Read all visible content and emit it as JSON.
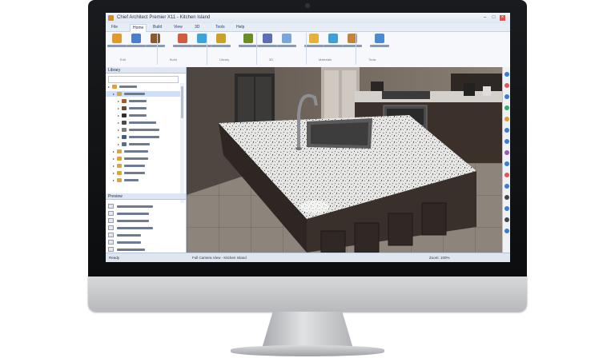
{
  "app": {
    "title": "Chief Architect Premier X11 - Kitchen Island",
    "tabs": [
      "File",
      "Home",
      "Build",
      "View",
      "3D",
      "Tools",
      "Help"
    ],
    "active_tab": "Home"
  },
  "ribbon": {
    "groups": [
      "Edit",
      "Build",
      "Library",
      "3D",
      "Materials",
      "Tools"
    ],
    "buttons": [
      {
        "icon": "select-icon",
        "color": "#e09b2d"
      },
      {
        "icon": "wall-icon",
        "color": "#4b7fc8"
      },
      {
        "icon": "cabinet-icon",
        "color": "#8c5a2b"
      },
      {
        "icon": "door-icon",
        "color": "#d15b3c"
      },
      {
        "icon": "window-icon",
        "color": "#3aa6d8"
      },
      {
        "icon": "room-icon",
        "color": "#c9a227"
      },
      {
        "icon": "roof-icon",
        "color": "#6b8e23"
      },
      {
        "icon": "camera-icon",
        "color": "#5a6fb8"
      },
      {
        "icon": "render-icon",
        "color": "#7aa7d8"
      },
      {
        "icon": "material-icon",
        "color": "#e3b23c"
      },
      {
        "icon": "paint-icon",
        "color": "#3fa0d6"
      },
      {
        "icon": "measure-icon",
        "color": "#c1843a"
      },
      {
        "icon": "layer-icon",
        "color": "#4a8bd0"
      }
    ]
  },
  "library": {
    "header": "Library",
    "search_placeholder": "Search Library",
    "tree": [
      {
        "label": "Architectural",
        "selected": false,
        "color": "#d9a441",
        "level": 0
      },
      {
        "label": "Cabinets",
        "selected": true,
        "color": "#d9a441",
        "level": 1
      },
      {
        "label": "Base Cabinets",
        "selected": false,
        "color": "#a35b2c",
        "level": 2
      },
      {
        "label": "Wall Cabinets",
        "selected": false,
        "color": "#6a4a2a",
        "level": 2
      },
      {
        "label": "Islands",
        "selected": false,
        "color": "#2f2f2f",
        "level": 2
      },
      {
        "label": "Appliances",
        "selected": false,
        "color": "#4a4a4a",
        "level": 2
      },
      {
        "label": "Countertops",
        "selected": false,
        "color": "#7a7a7a",
        "level": 2
      },
      {
        "label": "Sinks",
        "selected": false,
        "color": "#3b5b8a",
        "level": 2
      },
      {
        "label": "Fixtures",
        "selected": false,
        "color": "#5e6e7e",
        "level": 2
      },
      {
        "label": "Interiors",
        "selected": false,
        "color": "#d9a441",
        "level": 1
      },
      {
        "label": "Materials",
        "selected": false,
        "color": "#d9a441",
        "level": 1
      },
      {
        "label": "Exterior",
        "selected": false,
        "color": "#d9a441",
        "level": 1
      },
      {
        "label": "Lighting",
        "selected": false,
        "color": "#d9a441",
        "level": 1
      },
      {
        "label": "User Catalog",
        "selected": false,
        "color": "#d9a441",
        "level": 1
      }
    ],
    "preview_header": "Preview",
    "catalog_items": [
      "Granite Countertop",
      "Quartz Countertop",
      "Marble Countertop",
      "Butcher Block",
      "Stainless Steel Sink",
      "Undermount Sink",
      "Faucet"
    ]
  },
  "status": {
    "left": "Ready",
    "middle": "Full Camera View - Kitchen Island",
    "right": "Zoom: 100%"
  },
  "rightbar_colors": [
    "#3a7bd5",
    "#e0574f",
    "#3a7bd5",
    "#3aa66b",
    "#e09b2d",
    "#3a7bd5",
    "#3a7bd5",
    "#9b59b6",
    "#3a7bd5",
    "#e0574f",
    "#3a7bd5",
    "#444444",
    "#3a7bd5",
    "#444444",
    "#3a7bd5"
  ]
}
